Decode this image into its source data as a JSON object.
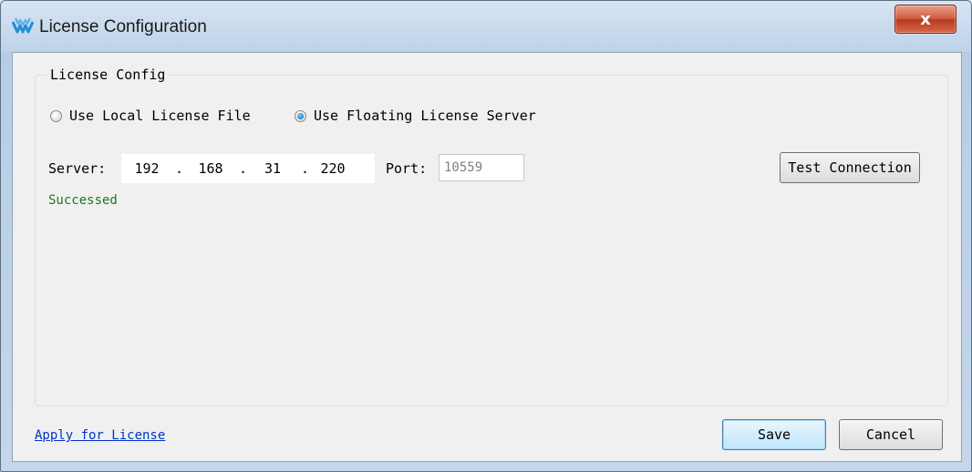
{
  "window": {
    "title": "License Configuration",
    "close_glyph": "x",
    "icon": "gowin-logo-icon"
  },
  "group": {
    "title": "License Config",
    "options": [
      {
        "label": "Use Local License File",
        "selected": false
      },
      {
        "label": "Use Floating License Server",
        "selected": true
      }
    ]
  },
  "server": {
    "label": "Server:",
    "ip": [
      "192",
      "168",
      "31",
      "220"
    ],
    "separator": ".",
    "port_label": "Port:",
    "port_value": "10559"
  },
  "test_button": "Test Connection",
  "status": {
    "text": "Successed",
    "color": "#1c7a1c"
  },
  "footer": {
    "apply_link": "Apply for License",
    "save": "Save",
    "cancel": "Cancel"
  }
}
